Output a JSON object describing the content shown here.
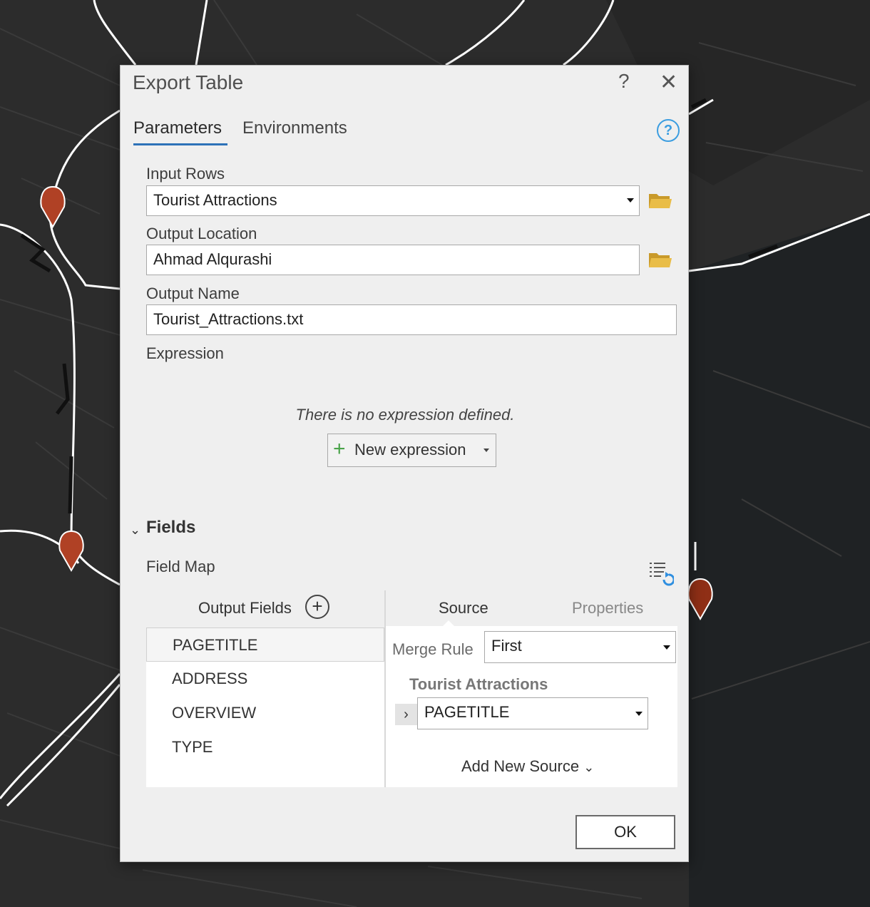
{
  "dialog": {
    "title": "Export Table",
    "help_glyph": "?",
    "close_glyph": "✕"
  },
  "tabs": {
    "parameters": "Parameters",
    "environments": "Environments"
  },
  "help_icon_glyph": "?",
  "params": {
    "input_rows": {
      "label": "Input Rows",
      "value": "Tourist Attractions"
    },
    "output_location": {
      "label": "Output Location",
      "value": "Ahmad Alqurashi"
    },
    "output_name": {
      "label": "Output Name",
      "value": "Tourist_Attractions.txt"
    },
    "expression": {
      "label": "Expression",
      "empty_text": "There is no expression defined.",
      "new_button": "New expression"
    }
  },
  "fields": {
    "title": "Fields",
    "field_map_label": "Field Map",
    "output_fields_title": "Output Fields",
    "output_fields": [
      "PAGETITLE",
      "ADDRESS",
      "OVERVIEW",
      "TYPE"
    ],
    "source_tab": "Source",
    "properties_tab": "Properties",
    "merge_rule_label": "Merge Rule",
    "merge_rule_value": "First",
    "source_table": "Tourist Attractions",
    "source_field": "PAGETITLE",
    "add_new_source": "Add New Source"
  },
  "ok_label": "OK",
  "colors": {
    "accent": "#2d72b8",
    "help": "#3b9de0",
    "folder": "#e2b33a",
    "marker": "#a33d22",
    "map_bg": "#2b2b2b"
  },
  "icons": [
    "help-icon",
    "close-icon",
    "folder-icon",
    "plus-icon",
    "chevron-down-icon",
    "field-map-reset-icon",
    "add-circle-icon",
    "chevron-right-icon",
    "map-marker-icon"
  ]
}
